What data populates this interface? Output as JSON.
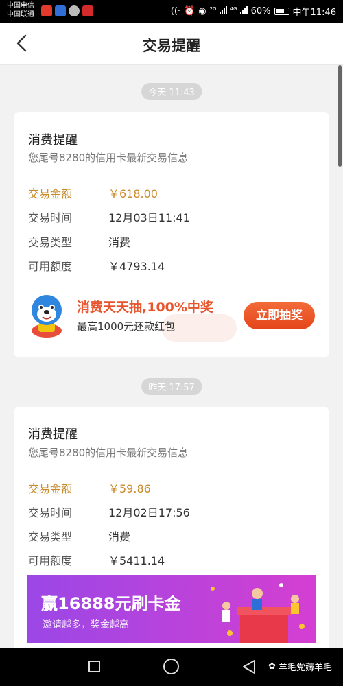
{
  "status_bar": {
    "carrier1": "中国电信",
    "carrier2": "中国联通",
    "net_tag_1": "2G",
    "net_tag_2": "4G",
    "battery": "60%",
    "time": "中午11:46"
  },
  "header": {
    "title": "交易提醒"
  },
  "messages": [
    {
      "time_pill": "今天 11:43",
      "title": "消费提醒",
      "subtitle": "您尾号8280的信用卡最新交易信息",
      "rows": [
        {
          "label": "交易金额",
          "value": "￥618.00"
        },
        {
          "label": "交易时间",
          "value": "12月03日11:41"
        },
        {
          "label": "交易类型",
          "value": "消费"
        },
        {
          "label": "可用额度",
          "value": "￥4793.14"
        }
      ],
      "banner": {
        "headline": "消费天天抽,100%中奖",
        "subline": "最高1000元还款红包",
        "button": "立即抽奖"
      }
    },
    {
      "time_pill": "昨天 17:57",
      "title": "消费提醒",
      "subtitle": "您尾号8280的信用卡最新交易信息",
      "rows": [
        {
          "label": "交易金额",
          "value": "￥59.86"
        },
        {
          "label": "交易时间",
          "value": "12月02日17:56"
        },
        {
          "label": "交易类型",
          "value": "消费"
        },
        {
          "label": "可用额度",
          "value": "￥5411.14"
        }
      ],
      "banner": {
        "headline": "赢16888元刷卡金",
        "subline": "邀请越多，奖金越高"
      }
    }
  ],
  "watermark": "羊毛党薅羊毛",
  "colors": {
    "accent_amount": "#c98b2c",
    "button": "#e4451b",
    "banner2": "#9b47e6"
  }
}
